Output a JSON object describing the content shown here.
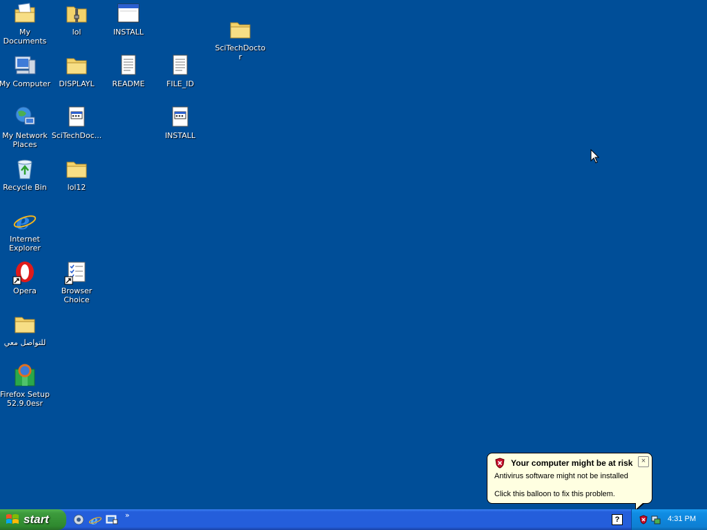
{
  "desktop": {
    "icons": [
      {
        "label": "My Documents",
        "type": "my-documents"
      },
      {
        "label": "lol",
        "type": "folder-zip"
      },
      {
        "label": "INSTALL",
        "type": "window-app"
      },
      {
        "label": "SciTechDoctor",
        "type": "folder"
      },
      {
        "label": "My Computer",
        "type": "my-computer"
      },
      {
        "label": "DISPLAYL",
        "type": "folder"
      },
      {
        "label": "README",
        "type": "text-file"
      },
      {
        "label": "FILE_ID",
        "type": "text-file"
      },
      {
        "label": "My Network Places",
        "type": "network"
      },
      {
        "label": "SciTechDoc...",
        "type": "settings-file"
      },
      {
        "label": "INSTALL",
        "type": "settings-file"
      },
      {
        "label": "Recycle Bin",
        "type": "recycle-bin"
      },
      {
        "label": "lol12",
        "type": "folder"
      },
      {
        "label": "Internet Explorer",
        "type": "ie"
      },
      {
        "label": "Opera",
        "type": "opera"
      },
      {
        "label": "Browser Choice",
        "type": "checklist"
      },
      {
        "label": "للتواصل معي",
        "type": "folder"
      },
      {
        "label": "Firefox Setup 52.9.0esr",
        "type": "installer"
      }
    ]
  },
  "balloon": {
    "title": "Your computer might be at risk",
    "line1": "Antivirus software might not be installed",
    "line2": "Click this balloon to fix this problem.",
    "close": "×"
  },
  "taskbar": {
    "start_label": "start",
    "quicklaunch_more": "»",
    "help": "?",
    "clock": "4:31 PM"
  },
  "colors": {
    "desktop": "#004e98",
    "taskbar": "#245edb",
    "start": "#2f8a2f",
    "balloon": "#ffffe1"
  }
}
